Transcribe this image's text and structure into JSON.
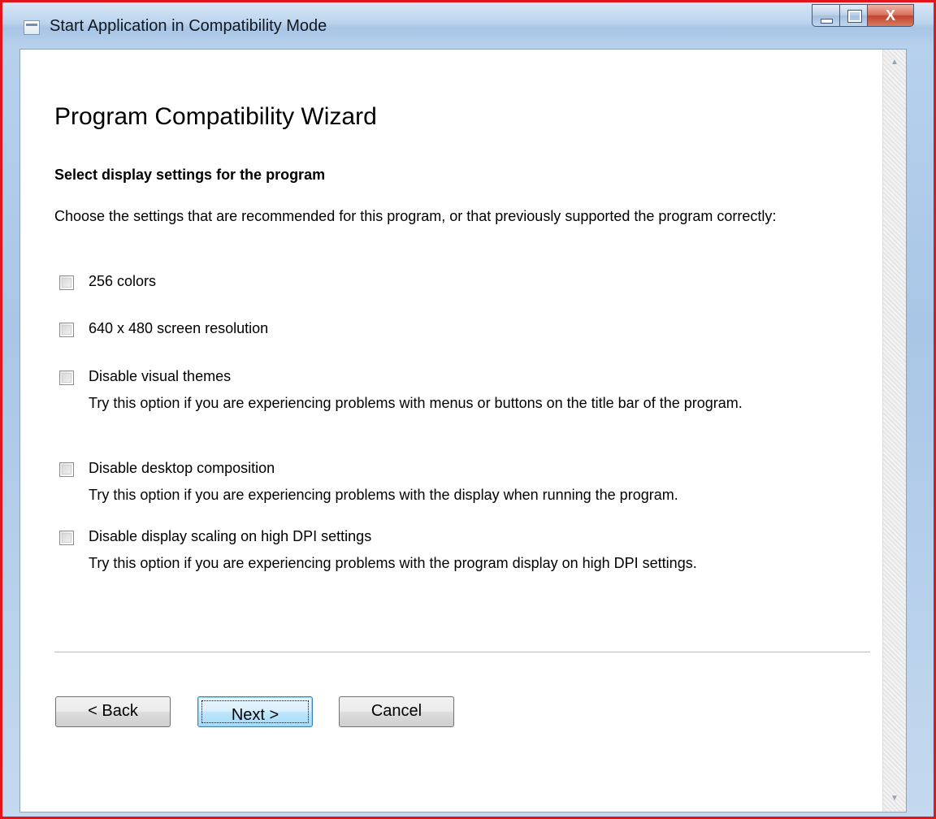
{
  "window": {
    "title": "Start Application in Compatibility Mode",
    "close_glyph": "X",
    "icons": {
      "app": "window-icon",
      "minimize": "minimize-icon",
      "maximize": "maximize-icon",
      "close": "close-icon"
    }
  },
  "wizard": {
    "heading": "Program Compatibility Wizard",
    "subheading": "Select display settings for the program",
    "instructions": "Choose the settings that are recommended for this program, or that previously supported the program correctly:",
    "options": [
      {
        "label": "256 colors",
        "checked": false
      },
      {
        "label": "640 x 480 screen resolution",
        "checked": false
      },
      {
        "label": "Disable visual themes",
        "description": "Try this option if you are experiencing problems with menus or buttons on the title bar of the program.",
        "checked": false
      },
      {
        "label": "Disable desktop composition",
        "description": "Try this option if you are experiencing problems with the display when running the program.",
        "checked": false
      },
      {
        "label": "Disable display scaling on high DPI settings",
        "description": "Try this option if you are experiencing problems with the program display on high DPI settings.",
        "checked": false
      }
    ]
  },
  "buttons": {
    "back": "< Back",
    "next": "Next >",
    "cancel": "Cancel"
  },
  "scrollbar": {
    "up_glyph": "▲",
    "down_glyph": "▼"
  },
  "colors": {
    "window_border": "#e0161c",
    "title_bar": "#bcd4ee",
    "close_button": "#c2442c",
    "default_button_border": "#3c7fb1"
  }
}
